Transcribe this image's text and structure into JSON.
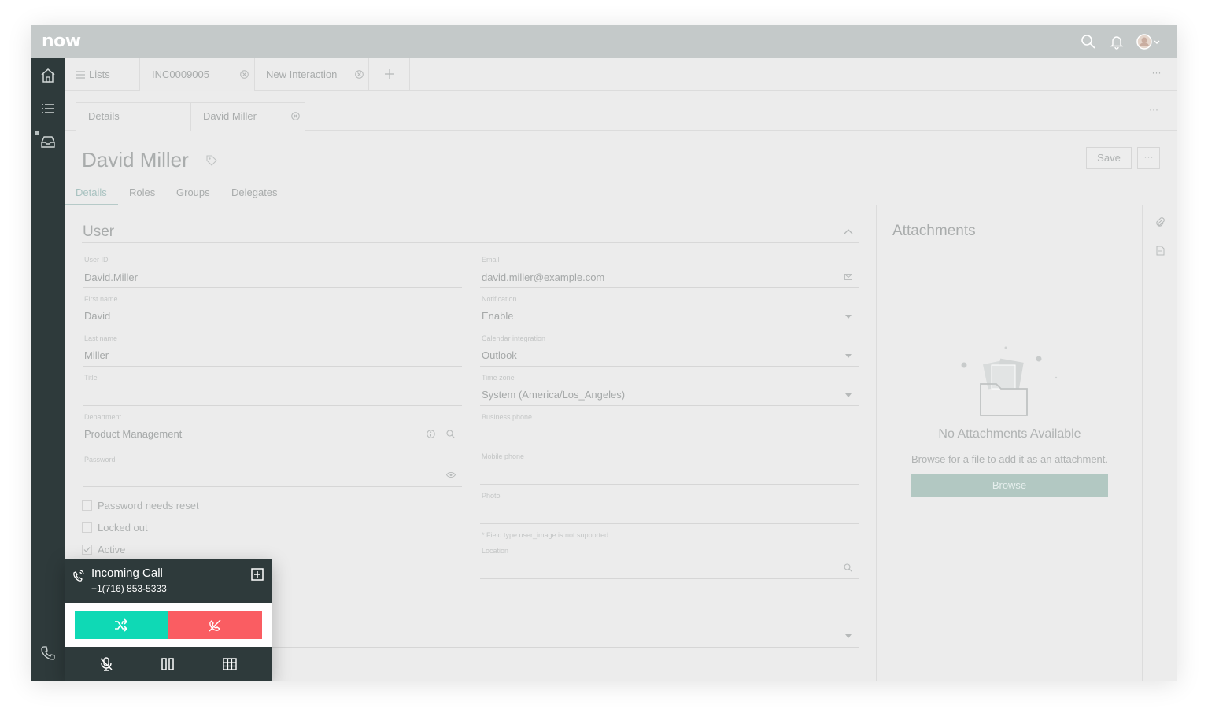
{
  "app": {
    "logo": "now"
  },
  "tabs": [
    {
      "label": "Lists"
    },
    {
      "label": "INC0009005"
    },
    {
      "label": "New Interaction"
    }
  ],
  "subtabs": [
    {
      "label": "Details"
    },
    {
      "label": "David Miller"
    }
  ],
  "record": {
    "title": "David Miller",
    "save_label": "Save",
    "more_label": "···"
  },
  "form_tabs": [
    "Details",
    "Roles",
    "Groups",
    "Delegates"
  ],
  "section": {
    "title": "User"
  },
  "fields_left": [
    {
      "label": "User ID",
      "value": "David.Miller"
    },
    {
      "label": "First name",
      "value": "David"
    },
    {
      "label": "Last name",
      "value": "Miller"
    },
    {
      "label": "Title",
      "value": ""
    },
    {
      "label": "Department",
      "value": "Product Management"
    },
    {
      "label": "Password",
      "value": ""
    }
  ],
  "fields_right": [
    {
      "label": "Email",
      "value": "david.miller@example.com"
    },
    {
      "label": "Notification",
      "value": "Enable"
    },
    {
      "label": "Calendar integration",
      "value": "Outlook"
    },
    {
      "label": "Time zone",
      "value": "System (America/Los_Angeles)"
    },
    {
      "label": "Business phone",
      "value": ""
    },
    {
      "label": "Mobile phone",
      "value": ""
    },
    {
      "label": "Photo",
      "value": ""
    }
  ],
  "photo_note": "* Field type user_image is not supported.",
  "location": {
    "label": "Location",
    "value": ""
  },
  "checkboxes": [
    {
      "label": "Password needs reset",
      "checked": false
    },
    {
      "label": "Locked out",
      "checked": false
    },
    {
      "label": "Active",
      "checked": true
    }
  ],
  "attachments": {
    "title": "Attachments",
    "empty_title": "No Attachments Available",
    "empty_sub": "Browse for a file to add it as an attachment.",
    "browse_label": "Browse"
  },
  "call": {
    "title": "Incoming Call",
    "number": "+1(716) 853-5333",
    "accept_color": "#0fd9b5",
    "decline_color": "#fa5d62"
  }
}
